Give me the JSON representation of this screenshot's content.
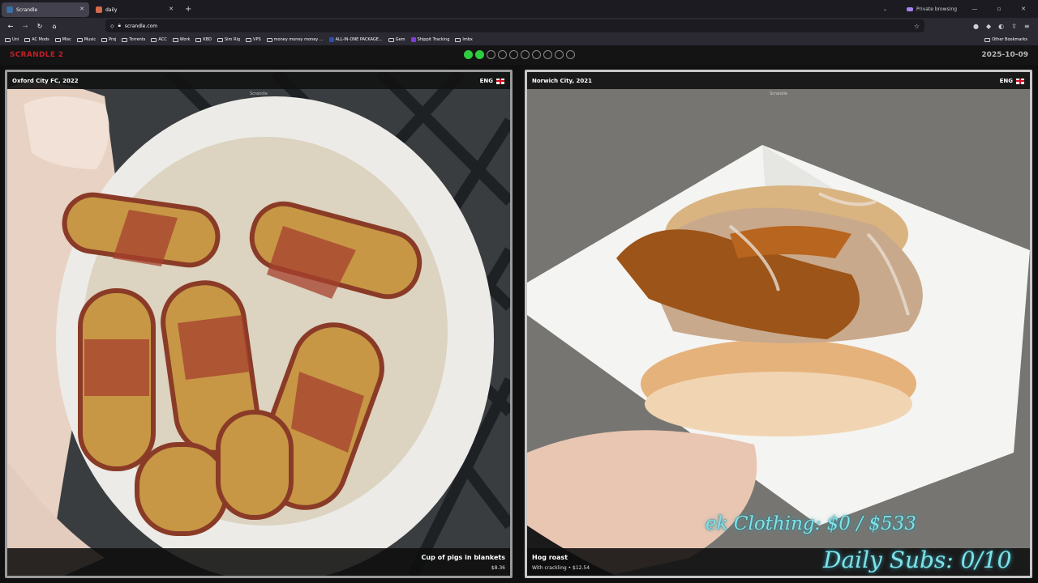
{
  "browser": {
    "tabs": [
      {
        "title": "Scrandle",
        "active": true
      },
      {
        "title": "daily",
        "active": false
      }
    ],
    "new_tab": "+",
    "private_label": "Private browsing",
    "url": "scrandle.com",
    "bookmarks": [
      "Uni",
      "AC Mods",
      "Misc",
      "Music",
      "Proj",
      "Torrents",
      "ACC",
      "Work",
      "KBD",
      "Sim Rig",
      "VPS",
      "money money money ...",
      "ALL-IN-ONE PACKAGE...",
      "Gem",
      "Shippit Tracking",
      "Imbx"
    ],
    "other_bookmarks": "Other Bookmarks"
  },
  "app": {
    "logo": "SCRANDLE 2",
    "date": "2025-10-09",
    "progress": {
      "completed": 2,
      "total": 10
    },
    "colors": {
      "logo": "#c21f28",
      "progress_done": "#2ecc40"
    },
    "watermark": "Scrandle"
  },
  "cards": [
    {
      "location": "Oxford City FC, 2022",
      "country": "ENG",
      "dish": "Cup of pigs in blankets",
      "subtitle": "$8.36"
    },
    {
      "location": "Norwich City, 2021",
      "country": "ENG",
      "dish": "Hog roast",
      "subtitle": "With crackling • $12.54"
    }
  ],
  "overlay": {
    "line1": "ek Clothing: $0 / $533",
    "line2": "Daily Subs: 0/10",
    "color": "#7fe3e8"
  }
}
